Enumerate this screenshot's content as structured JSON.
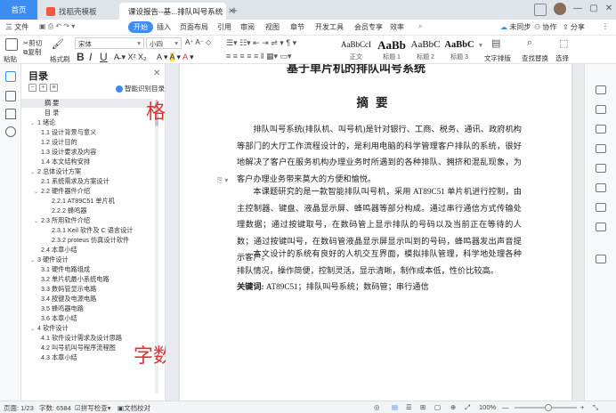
{
  "tabs": {
    "home": "首页",
    "template": "找稻壳模板",
    "doc": "课设报告--基...排队叫号系统",
    "new": "+"
  },
  "menu": {
    "file": "三 文件",
    "items": [
      "开始",
      "插入",
      "页面布局",
      "引用",
      "审阅",
      "视图",
      "章节",
      "开发工具",
      "会员专享",
      "效率"
    ],
    "active": "开始",
    "unsync": "未同步",
    "collab": "协作",
    "share": "分享"
  },
  "ribbon": {
    "paste": "粘贴",
    "cut": "剪切",
    "copy": "复制",
    "format_painter": "格式刷",
    "font_name": "宋体",
    "font_size": "小四",
    "styles": [
      {
        "sample": "AaBbCcI",
        "name": "正文"
      },
      {
        "sample": "AaBb",
        "name": "标题 1"
      },
      {
        "sample": "AaBbC",
        "name": "标题 2"
      },
      {
        "sample": "AaBbC",
        "name": "标题 3"
      }
    ],
    "text_layout": "文字排版",
    "find_replace": "查找替换",
    "select": "选择"
  },
  "toc": {
    "title": "目录",
    "smart": "智能识别目录",
    "items": [
      {
        "text": "摘  要",
        "level": 0,
        "selected": true
      },
      {
        "text": "目  录",
        "level": 0
      },
      {
        "text": "1 绪论",
        "level": 0,
        "arrow": true
      },
      {
        "text": "1.1 设计背景与意义",
        "level": 1
      },
      {
        "text": "1.2 设计目的",
        "level": 1
      },
      {
        "text": "1.3 设计要求及内容",
        "level": 1
      },
      {
        "text": "1.4 本文结构安排",
        "level": 1
      },
      {
        "text": "2 总体设计方案",
        "level": 0,
        "arrow": true
      },
      {
        "text": "2.1 系统需求及方案设计",
        "level": 1
      },
      {
        "text": "2.2 硬件器件介绍",
        "level": 1,
        "arrow": true
      },
      {
        "text": "2.2.1 AT89C51 单片机",
        "level": 2
      },
      {
        "text": "2.2.2 蜂鸣器",
        "level": 2
      },
      {
        "text": "2.3 所用软件介绍",
        "level": 1,
        "arrow": true
      },
      {
        "text": "2.3.1 Keil 软件及 C 语言设计",
        "level": 2
      },
      {
        "text": "2.3.2 proteus 仿真设计软件",
        "level": 2
      },
      {
        "text": "2.4 本章小结",
        "level": 1
      },
      {
        "text": "3 硬件设计",
        "level": 0,
        "arrow": true
      },
      {
        "text": "3.1 硬件电路组成",
        "level": 1
      },
      {
        "text": "3.2 单片机最小系统电路",
        "level": 1
      },
      {
        "text": "3.3 数码管显示电路",
        "level": 1
      },
      {
        "text": "3.4 按键及电源电路",
        "level": 1
      },
      {
        "text": "3.5 蜂鸣器电路",
        "level": 1
      },
      {
        "text": "3.6 本章小结",
        "level": 1
      },
      {
        "text": "4 软件设计",
        "level": 0,
        "arrow": true
      },
      {
        "text": "4.1 软件设计需求及设计思路",
        "level": 1
      },
      {
        "text": "4.2 叫号机叫号程序流程图",
        "level": 1
      },
      {
        "text": "4.3 本章小结",
        "level": 1
      }
    ]
  },
  "overlay": {
    "format": "格式规范",
    "wordcount": "字数6584"
  },
  "doc": {
    "header_cut": "基于单片机的排队叫号系统",
    "abstract_title": "摘要",
    "para1": "排队叫号系统(排队机、叫号机)是针对银行、工商、税务、通讯、政府机构等部门的大厅工作流程设计的，是利用电脑的科学管理客户排队的系统，很好地解决了客户在服务机构办理业务时所遇到的各种排队、拥挤和混乱现象，为客户办理业务带来莫大的方便和愉悦。",
    "para2": "本课题研究的是一款智能排队叫号机，采用 AT89C51 单片机进行控制，由主控制器、键盘、液晶显示屏、蜂鸣器等部分构成。通过串行通信方式传输处理数据；通过按键取号，在数码管上显示排队的号码以及当前正在等待的人数；通过按键叫号，在数码管液晶显示屏显示叫到的号码，蜂鸣器发出声音提示客户。",
    "para3": "本文设计的系统有良好的人机交互界面，模拟排队管理，科学地处理各种排队情况，操作简便，控制灵活，显示清晰，制作成本低，性价比较高。",
    "keywords_label": "关键词:",
    "keywords": " AT89C51；排队叫号系统；数码管；串行通信"
  },
  "status": {
    "page": "页面: 1/23",
    "words": "字数: 6584",
    "spell": "拼写检查",
    "proof": "文档校对",
    "zoom": "100%"
  },
  "colors": {
    "accent": "#3c8cf2",
    "overlay_red": "#e0302f"
  }
}
